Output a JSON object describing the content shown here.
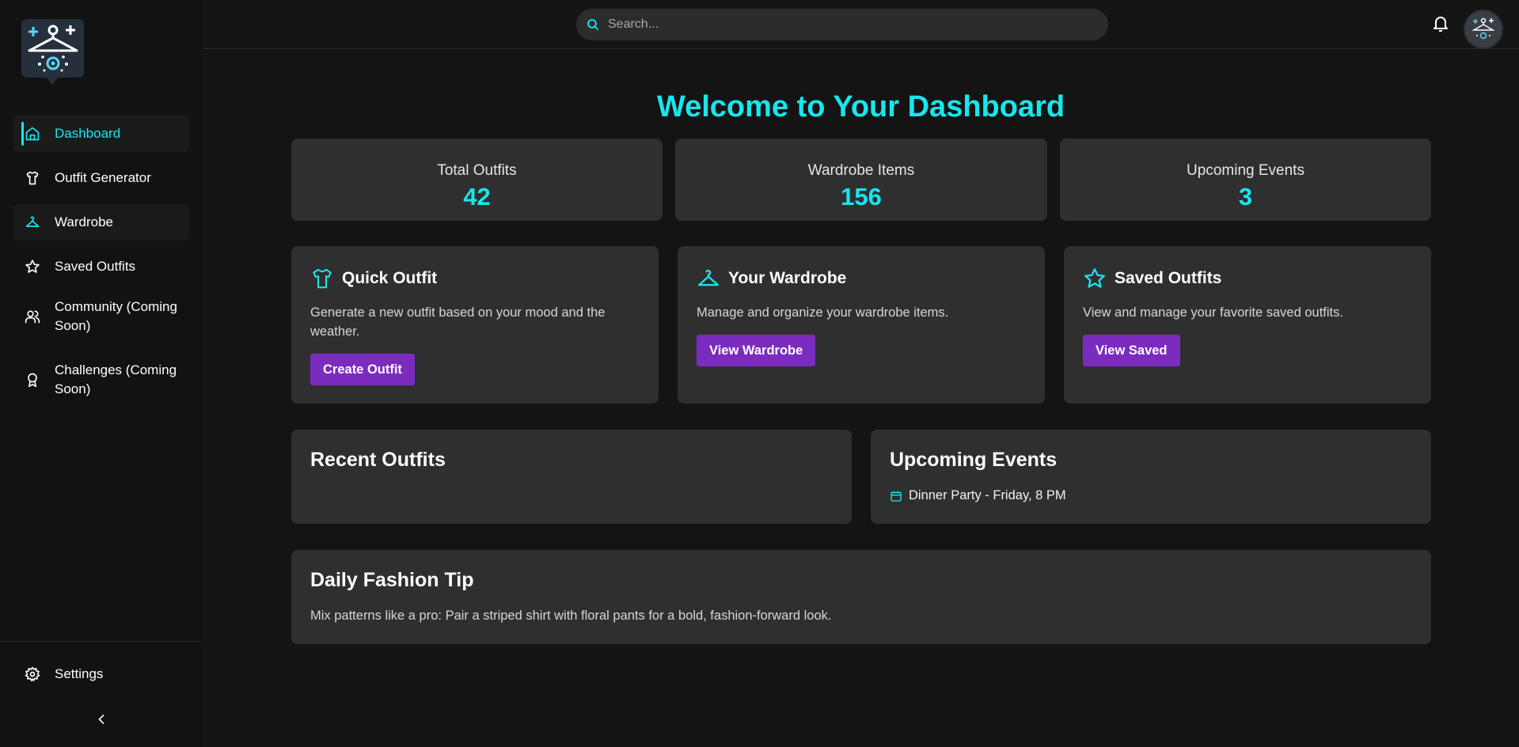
{
  "sidebar": {
    "items": [
      {
        "label": "Dashboard",
        "icon": "home-icon"
      },
      {
        "label": "Outfit Generator",
        "icon": "shirt-icon"
      },
      {
        "label": "Wardrobe",
        "icon": "hanger-icon"
      },
      {
        "label": "Saved Outfits",
        "icon": "star-icon"
      },
      {
        "label": "Community (Coming Soon)",
        "icon": "users-icon"
      },
      {
        "label": "Challenges (Coming Soon)",
        "icon": "award-icon"
      }
    ],
    "settings_label": "Settings",
    "collapse_icon": "chevron-left-icon"
  },
  "header": {
    "search_placeholder": "Search..."
  },
  "main": {
    "title": "Welcome to Your Dashboard",
    "stats": [
      {
        "label": "Total Outfits",
        "value": "42"
      },
      {
        "label": "Wardrobe Items",
        "value": "156"
      },
      {
        "label": "Upcoming Events",
        "value": "3"
      }
    ],
    "quick_actions": [
      {
        "title": "Quick Outfit",
        "description": "Generate a new outfit based on your mood and the weather.",
        "button": "Create Outfit",
        "icon": "shirt-icon"
      },
      {
        "title": "Your Wardrobe",
        "description": "Manage and organize your wardrobe items.",
        "button": "View Wardrobe",
        "icon": "hanger-icon"
      },
      {
        "title": "Saved Outfits",
        "description": "View and manage your favorite saved outfits.",
        "button": "View Saved",
        "icon": "star-icon"
      }
    ],
    "recent_outfits": {
      "title": "Recent Outfits"
    },
    "upcoming_events": {
      "title": "Upcoming Events",
      "events": [
        "Dinner Party - Friday, 8 PM"
      ]
    },
    "daily_tip": {
      "title": "Daily Fashion Tip",
      "text": "Mix patterns like a pro: Pair a striped shirt with floral pants for a bold, fashion-forward look."
    }
  },
  "colors": {
    "accent": "#18e6ee",
    "button": "#7b2cbf",
    "card": "#2f2f2f",
    "background": "#141414"
  }
}
